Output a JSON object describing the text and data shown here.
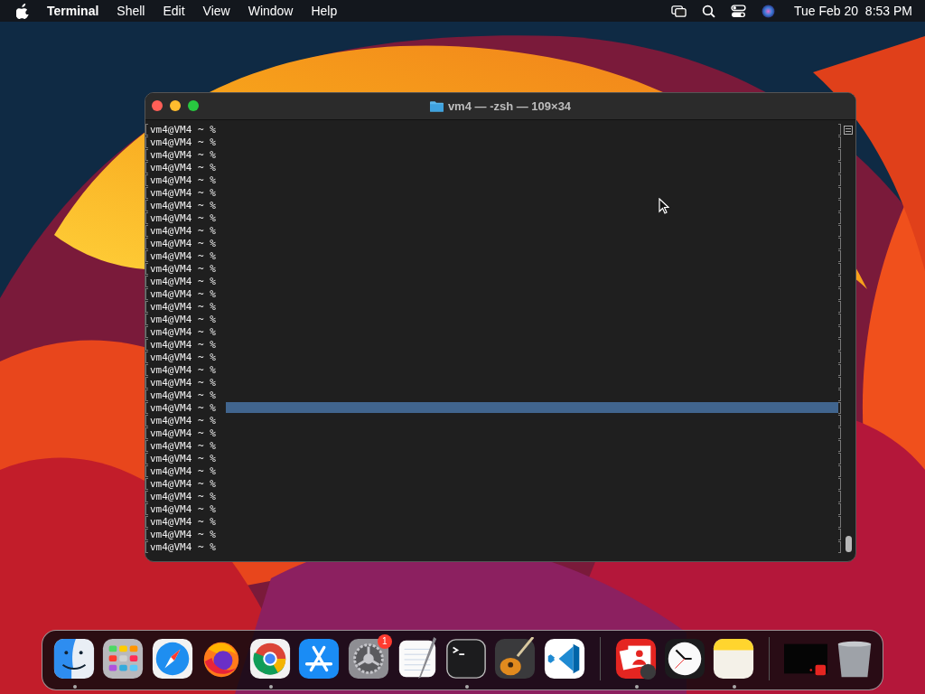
{
  "menu_bar": {
    "app_name": "Terminal",
    "menus": [
      "Shell",
      "Edit",
      "View",
      "Window",
      "Help"
    ],
    "clock": "Tue Feb 20  8:53 PM"
  },
  "window": {
    "title": "vm4 — -zsh — 109×34",
    "lines": [
      {
        "text": "vm4@VM4 ~ %",
        "selected": false
      },
      {
        "text": "vm4@VM4 ~ %",
        "selected": false
      },
      {
        "text": "vm4@VM4 ~ %",
        "selected": false
      },
      {
        "text": "vm4@VM4 ~ %",
        "selected": false
      },
      {
        "text": "vm4@VM4 ~ %",
        "selected": false
      },
      {
        "text": "vm4@VM4 ~ %",
        "selected": false
      },
      {
        "text": "vm4@VM4 ~ %",
        "selected": false
      },
      {
        "text": "vm4@VM4 ~ %",
        "selected": false
      },
      {
        "text": "vm4@VM4 ~ %",
        "selected": false
      },
      {
        "text": "vm4@VM4 ~ %",
        "selected": false
      },
      {
        "text": "vm4@VM4 ~ %",
        "selected": false
      },
      {
        "text": "vm4@VM4 ~ %",
        "selected": false
      },
      {
        "text": "vm4@VM4 ~ %",
        "selected": false
      },
      {
        "text": "vm4@VM4 ~ %",
        "selected": false
      },
      {
        "text": "vm4@VM4 ~ %",
        "selected": false
      },
      {
        "text": "vm4@VM4 ~ %",
        "selected": false
      },
      {
        "text": "vm4@VM4 ~ %",
        "selected": false
      },
      {
        "text": "vm4@VM4 ~ %",
        "selected": false
      },
      {
        "text": "vm4@VM4 ~ %",
        "selected": false
      },
      {
        "text": "vm4@VM4 ~ %",
        "selected": false
      },
      {
        "text": "vm4@VM4 ~ %",
        "selected": false
      },
      {
        "text": "vm4@VM4 ~ %",
        "selected": false
      },
      {
        "text": "vm4@VM4 ~ %",
        "selected": true
      },
      {
        "text": "vm4@VM4 ~ %",
        "selected": false
      },
      {
        "text": "vm4@VM4 ~ %",
        "selected": false
      },
      {
        "text": "vm4@VM4 ~ %",
        "selected": false
      },
      {
        "text": "vm4@VM4 ~ %",
        "selected": false
      },
      {
        "text": "vm4@VM4 ~ %",
        "selected": false
      },
      {
        "text": "vm4@VM4 ~ %",
        "selected": false
      },
      {
        "text": "vm4@VM4 ~ %",
        "selected": false
      },
      {
        "text": "vm4@VM4 ~ %",
        "selected": false
      },
      {
        "text": "vm4@VM4 ~ %",
        "selected": false
      },
      {
        "text": "vm4@VM4 ~ %",
        "selected": false
      },
      {
        "text": "vm4@VM4 ~ %",
        "selected": false
      }
    ]
  },
  "dock": {
    "groups": [
      [
        {
          "kind": "finder",
          "running": true
        },
        {
          "kind": "launchpad",
          "running": false
        },
        {
          "kind": "safari",
          "running": false
        },
        {
          "kind": "firefox",
          "running": false
        },
        {
          "kind": "chrome",
          "running": true
        },
        {
          "kind": "appstore",
          "running": false
        },
        {
          "kind": "settings",
          "running": false,
          "badge": "1"
        },
        {
          "kind": "textedit",
          "running": false
        },
        {
          "kind": "terminal",
          "running": true
        },
        {
          "kind": "guitar",
          "running": false
        },
        {
          "kind": "vscode",
          "running": false
        }
      ],
      [
        {
          "kind": "photobooth",
          "running": true
        },
        {
          "kind": "clock",
          "running": false
        },
        {
          "kind": "notes",
          "running": true
        }
      ],
      [
        {
          "kind": "thumbnail",
          "running": false
        },
        {
          "kind": "trash",
          "running": false
        }
      ]
    ]
  }
}
